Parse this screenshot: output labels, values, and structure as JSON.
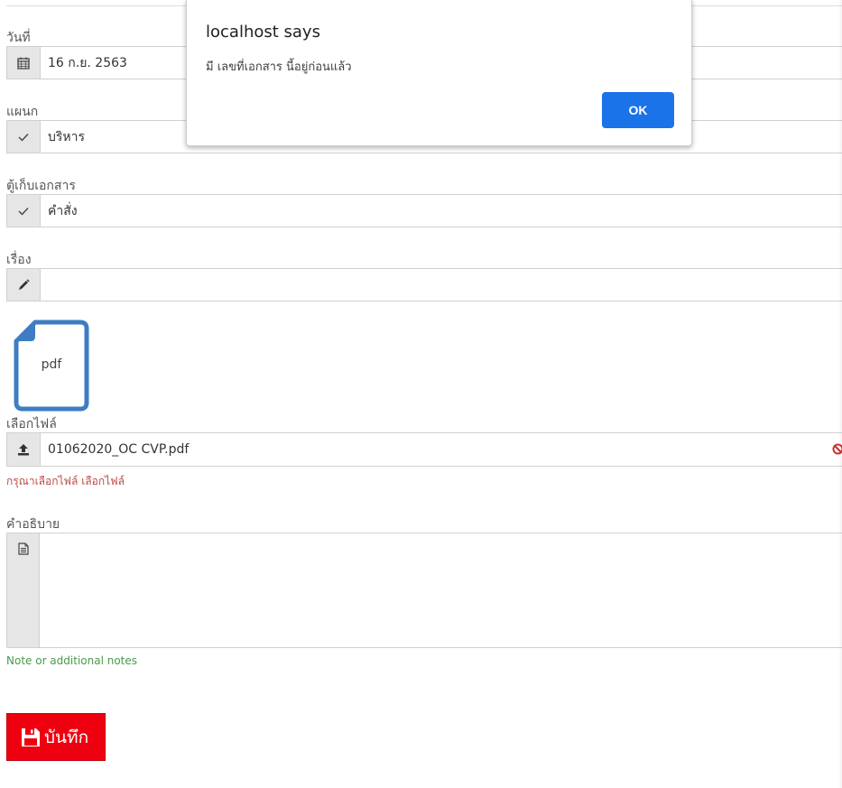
{
  "form": {
    "date": {
      "label": "วันที่",
      "value": "16 ก.ย. 2563",
      "icon": "calendar-icon"
    },
    "department": {
      "label": "แผนก",
      "value": "บริหาร",
      "icon": "check-icon"
    },
    "cabinet": {
      "label": "ตู้เก็บเอกสาร",
      "value": "คำสั่ง",
      "icon": "check-icon"
    },
    "subject": {
      "label": "เรื่อง",
      "value": "",
      "icon": "pencil-icon"
    },
    "file": {
      "preview_label": "pdf",
      "label": "เลือกไฟล์",
      "value": "01062020_OC CVP.pdf",
      "icon": "upload-icon",
      "help": "กรุณาเลือกไฟล์ เลือกไฟล์"
    },
    "description": {
      "label": "คำอธิบาย",
      "value": "",
      "icon": "document-icon",
      "help": "Note or additional notes"
    },
    "save_button": {
      "label": "บันทึก",
      "icon": "floppy-disk-icon"
    }
  },
  "dialog": {
    "title": "localhost says",
    "message": "มี เลขที่เอกสาร นี้อยู่ก่อนแล้ว",
    "ok_label": "OK"
  },
  "colors": {
    "save_button": "#ee0010",
    "dialog_ok": "#1a73e8",
    "error_text": "#b94a48",
    "help_text": "#4a9a4a",
    "pdf_icon": "#3f7dc3"
  }
}
